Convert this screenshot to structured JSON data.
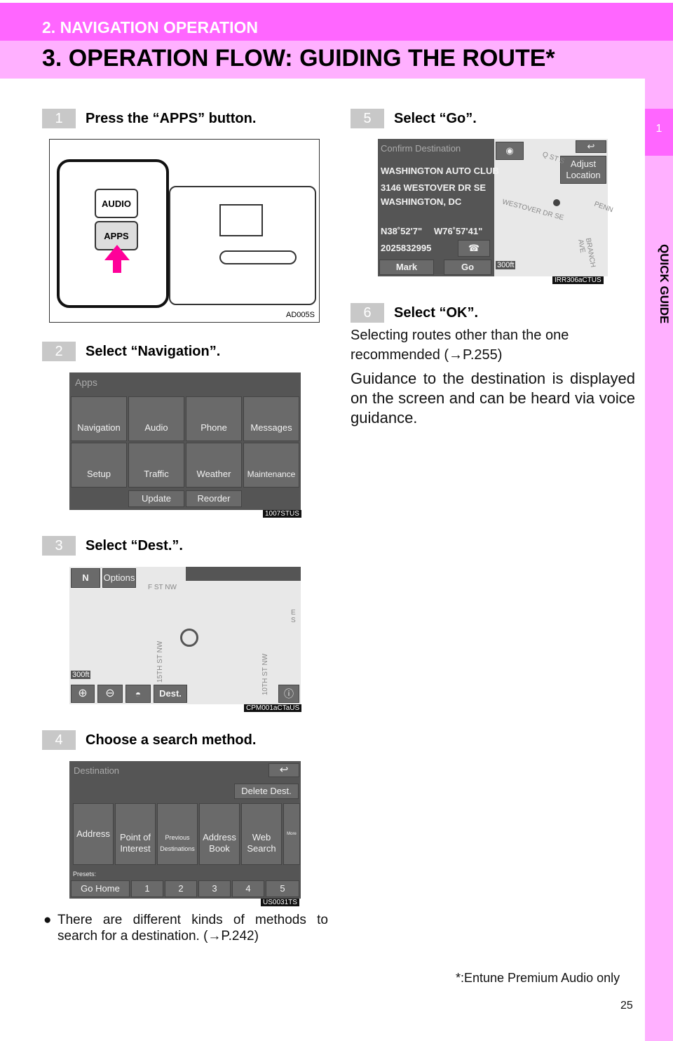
{
  "header": {
    "section": "2. NAVIGATION OPERATION",
    "title": "3. OPERATION FLOW: GUIDING THE ROUTE*"
  },
  "side_tab": {
    "number": "1",
    "label": "QUICK GUIDE"
  },
  "steps": [
    {
      "num": "1",
      "text": "Press the “APPS” button.",
      "figure": {
        "buttons": [
          "AUDIO",
          "APPS"
        ],
        "code": "AD005S"
      }
    },
    {
      "num": "2",
      "text": "Select “Navigation”.",
      "figure": {
        "title": "Apps",
        "tiles": [
          "Navigation",
          "Audio",
          "Phone",
          "Messages",
          "Setup",
          "Traffic",
          "Weather",
          "Maintenance"
        ],
        "bottom": [
          "Update",
          "Reorder"
        ],
        "code": "1007STUS"
      }
    },
    {
      "num": "3",
      "text": "Select “Dest.”.",
      "figure": {
        "n": "N",
        "options": "Options",
        "scale": "300ft",
        "dest": "Dest.",
        "streets": [
          "F ST NW",
          "15TH ST NW",
          "10TH ST NW",
          "E S"
        ],
        "code": "CPM001aCTaUS"
      }
    },
    {
      "num": "4",
      "text": "Choose a search method.",
      "figure": {
        "title": "Destination",
        "delete": "Delete Dest.",
        "tiles": [
          "Address",
          "Point of Interest",
          "Previous Destinations",
          "Address Book",
          "Web Search",
          "More"
        ],
        "presets_label": "Presets:",
        "presets": [
          "Go Home",
          "1",
          "2",
          "3",
          "4",
          "5"
        ],
        "code": "US0031TS"
      }
    },
    {
      "num": "5",
      "text": "Select “Go”.",
      "figure": {
        "title": "Confirm Destination",
        "name": "WASHINGTON AUTO CLUB",
        "addr1": "3146 WESTOVER DR SE",
        "addr2": "WASHINGTON, DC",
        "lat": "N38˚52'7\"",
        "lon": "W76˚57'41\"",
        "phone": "2025832995",
        "mark": "Mark",
        "go": "Go",
        "adjust": "Adjust Location",
        "scale": "300ft",
        "streets": [
          "Q ST S",
          "WESTOVER DR SE",
          "PENN",
          "BRANCH AVE"
        ],
        "code": "IRR306aCTUS"
      }
    },
    {
      "num": "6",
      "text": "Select “OK”."
    }
  ],
  "bullet": "There are different kinds of methods to search for a destination. (→P.242)",
  "note1": "Selecting routes other than the one recommended (→P.255)",
  "note2": "Guidance to the destination is displayed on the screen and can be heard via voice guidance.",
  "footnote": "*:Entune Premium Audio only",
  "page": "25"
}
